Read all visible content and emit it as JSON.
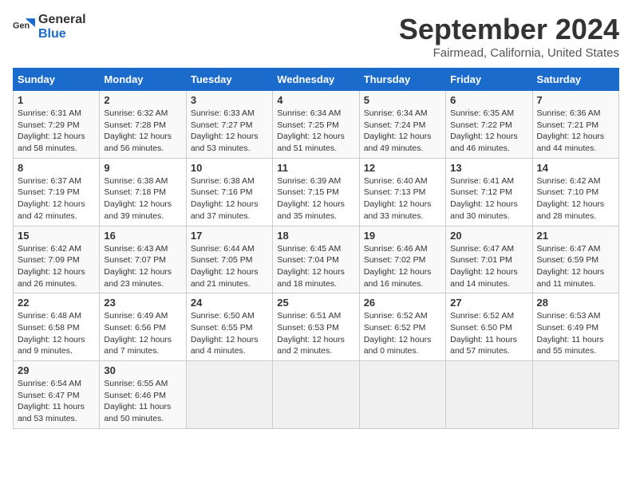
{
  "header": {
    "logo_general": "General",
    "logo_blue": "Blue",
    "month": "September 2024",
    "location": "Fairmead, California, United States"
  },
  "calendar": {
    "days_of_week": [
      "Sunday",
      "Monday",
      "Tuesday",
      "Wednesday",
      "Thursday",
      "Friday",
      "Saturday"
    ],
    "weeks": [
      [
        {
          "day": "",
          "empty": true
        },
        {
          "day": "2",
          "rise": "6:32 AM",
          "set": "7:28 PM",
          "daylight": "12 hours and 56 minutes."
        },
        {
          "day": "3",
          "rise": "6:33 AM",
          "set": "7:27 PM",
          "daylight": "12 hours and 53 minutes."
        },
        {
          "day": "4",
          "rise": "6:34 AM",
          "set": "7:25 PM",
          "daylight": "12 hours and 51 minutes."
        },
        {
          "day": "5",
          "rise": "6:34 AM",
          "set": "7:24 PM",
          "daylight": "12 hours and 49 minutes."
        },
        {
          "day": "6",
          "rise": "6:35 AM",
          "set": "7:22 PM",
          "daylight": "12 hours and 46 minutes."
        },
        {
          "day": "7",
          "rise": "6:36 AM",
          "set": "7:21 PM",
          "daylight": "12 hours and 44 minutes."
        }
      ],
      [
        {
          "day": "1",
          "rise": "6:31 AM",
          "set": "7:29 PM",
          "daylight": "12 hours and 58 minutes."
        },
        {
          "day": "",
          "empty": true
        },
        {
          "day": "",
          "empty": true
        },
        {
          "day": "",
          "empty": true
        },
        {
          "day": "",
          "empty": true
        },
        {
          "day": "",
          "empty": true
        },
        {
          "day": "",
          "empty": true
        }
      ],
      [
        {
          "day": "8",
          "rise": "6:37 AM",
          "set": "7:19 PM",
          "daylight": "12 hours and 42 minutes."
        },
        {
          "day": "9",
          "rise": "6:38 AM",
          "set": "7:18 PM",
          "daylight": "12 hours and 39 minutes."
        },
        {
          "day": "10",
          "rise": "6:38 AM",
          "set": "7:16 PM",
          "daylight": "12 hours and 37 minutes."
        },
        {
          "day": "11",
          "rise": "6:39 AM",
          "set": "7:15 PM",
          "daylight": "12 hours and 35 minutes."
        },
        {
          "day": "12",
          "rise": "6:40 AM",
          "set": "7:13 PM",
          "daylight": "12 hours and 33 minutes."
        },
        {
          "day": "13",
          "rise": "6:41 AM",
          "set": "7:12 PM",
          "daylight": "12 hours and 30 minutes."
        },
        {
          "day": "14",
          "rise": "6:42 AM",
          "set": "7:10 PM",
          "daylight": "12 hours and 28 minutes."
        }
      ],
      [
        {
          "day": "15",
          "rise": "6:42 AM",
          "set": "7:09 PM",
          "daylight": "12 hours and 26 minutes."
        },
        {
          "day": "16",
          "rise": "6:43 AM",
          "set": "7:07 PM",
          "daylight": "12 hours and 23 minutes."
        },
        {
          "day": "17",
          "rise": "6:44 AM",
          "set": "7:05 PM",
          "daylight": "12 hours and 21 minutes."
        },
        {
          "day": "18",
          "rise": "6:45 AM",
          "set": "7:04 PM",
          "daylight": "12 hours and 18 minutes."
        },
        {
          "day": "19",
          "rise": "6:46 AM",
          "set": "7:02 PM",
          "daylight": "12 hours and 16 minutes."
        },
        {
          "day": "20",
          "rise": "6:47 AM",
          "set": "7:01 PM",
          "daylight": "12 hours and 14 minutes."
        },
        {
          "day": "21",
          "rise": "6:47 AM",
          "set": "6:59 PM",
          "daylight": "12 hours and 11 minutes."
        }
      ],
      [
        {
          "day": "22",
          "rise": "6:48 AM",
          "set": "6:58 PM",
          "daylight": "12 hours and 9 minutes."
        },
        {
          "day": "23",
          "rise": "6:49 AM",
          "set": "6:56 PM",
          "daylight": "12 hours and 7 minutes."
        },
        {
          "day": "24",
          "rise": "6:50 AM",
          "set": "6:55 PM",
          "daylight": "12 hours and 4 minutes."
        },
        {
          "day": "25",
          "rise": "6:51 AM",
          "set": "6:53 PM",
          "daylight": "12 hours and 2 minutes."
        },
        {
          "day": "26",
          "rise": "6:52 AM",
          "set": "6:52 PM",
          "daylight": "12 hours and 0 minutes."
        },
        {
          "day": "27",
          "rise": "6:52 AM",
          "set": "6:50 PM",
          "daylight": "11 hours and 57 minutes."
        },
        {
          "day": "28",
          "rise": "6:53 AM",
          "set": "6:49 PM",
          "daylight": "11 hours and 55 minutes."
        }
      ],
      [
        {
          "day": "29",
          "rise": "6:54 AM",
          "set": "6:47 PM",
          "daylight": "11 hours and 53 minutes."
        },
        {
          "day": "30",
          "rise": "6:55 AM",
          "set": "6:46 PM",
          "daylight": "11 hours and 50 minutes."
        },
        {
          "day": "",
          "empty": true
        },
        {
          "day": "",
          "empty": true
        },
        {
          "day": "",
          "empty": true
        },
        {
          "day": "",
          "empty": true
        },
        {
          "day": "",
          "empty": true
        }
      ]
    ]
  }
}
